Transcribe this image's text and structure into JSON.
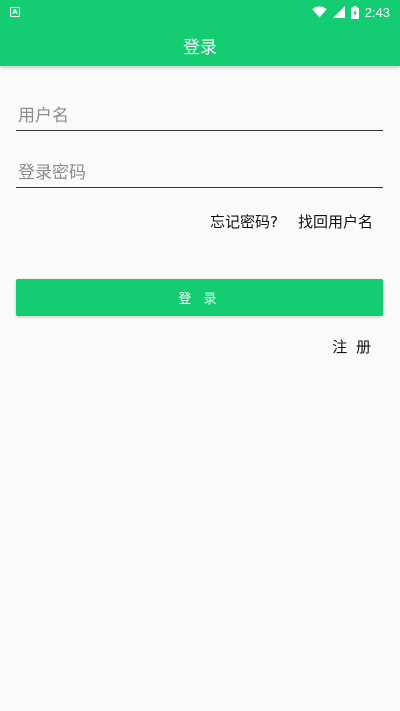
{
  "status_bar": {
    "time": "2:43",
    "notification_icon": "app-notification-icon",
    "notification_glyph": "A",
    "icons": [
      "wifi-icon",
      "cell-signal-icon",
      "battery-icon"
    ]
  },
  "app_bar": {
    "title": "登录"
  },
  "form": {
    "username_placeholder": "用户名",
    "username_value": "",
    "password_placeholder": "登录密码",
    "password_value": ""
  },
  "links": {
    "forgot_password": "忘记密码?",
    "retrieve_username": "找回用户名",
    "register": "注 册"
  },
  "buttons": {
    "login": "登 录"
  },
  "colors": {
    "accent": "#14cc72",
    "background": "#fafafa",
    "text": "#111111",
    "placeholder": "#8c8c8c"
  }
}
